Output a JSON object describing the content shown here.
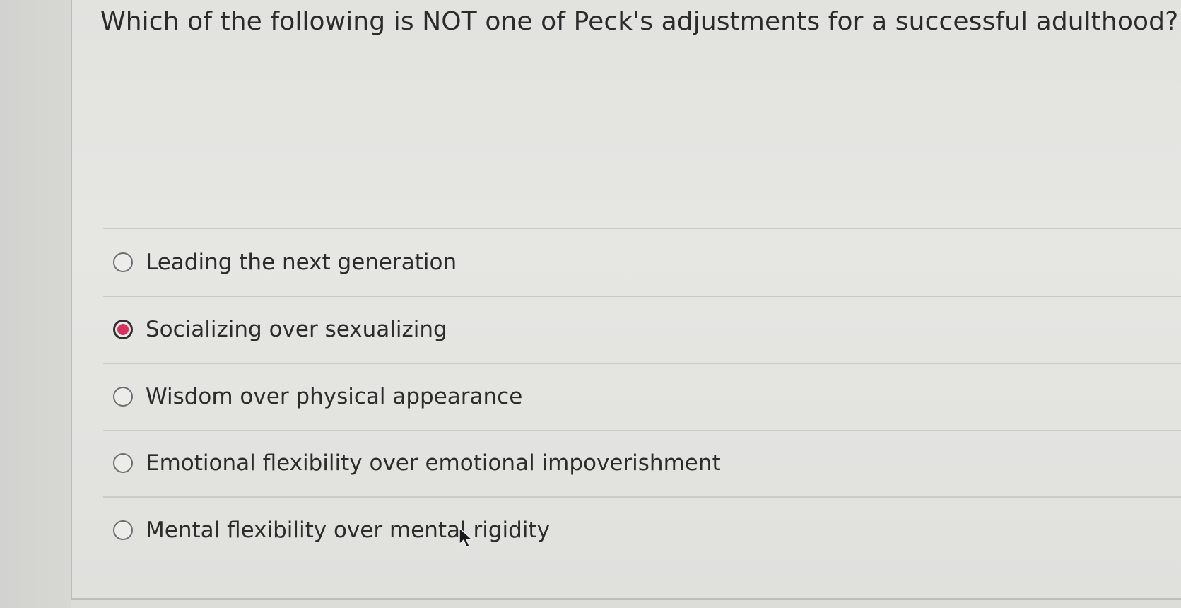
{
  "question": {
    "text": "Which of the following is NOT one of Peck's adjustments for a successful adulthood?"
  },
  "options": [
    {
      "label": "Leading the next generation",
      "selected": false
    },
    {
      "label": "Socializing over sexualizing",
      "selected": true
    },
    {
      "label": "Wisdom over physical appearance",
      "selected": false
    },
    {
      "label": "Emotional flexibility over emotional impoverishment",
      "selected": false
    },
    {
      "label": "Mental flexibility over mental rigidity",
      "selected": false
    }
  ],
  "colors": {
    "selected_dot": "#d6345e",
    "background": "#e2e2df",
    "text": "#2c2c2c"
  },
  "icons": {
    "cursor": "mouse-pointer-icon",
    "radio": "radio-button-icon"
  }
}
